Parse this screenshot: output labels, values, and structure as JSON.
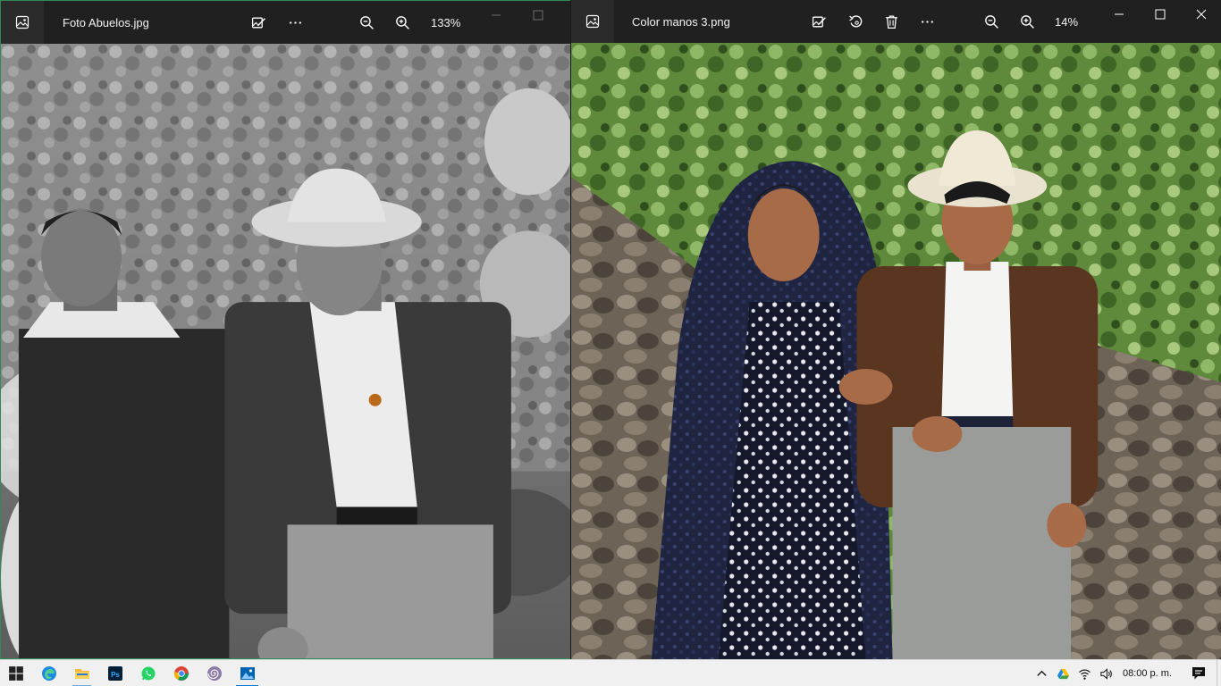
{
  "left_window": {
    "title": "Foto Abuelos.jpg",
    "zoom": "133%",
    "icons": [
      "photos-app-icon",
      "edit-image-icon",
      "more-icon",
      "zoom-out-icon",
      "zoom-in-icon",
      "minimize-icon",
      "maximize-icon"
    ],
    "photo_style": "black-and-white"
  },
  "right_window": {
    "title": "Color manos 3.png",
    "zoom": "14%",
    "icons": [
      "photos-app-icon",
      "edit-image-icon",
      "rotate-icon",
      "delete-icon",
      "more-icon",
      "zoom-out-icon",
      "zoom-in-icon",
      "minimize-icon",
      "maximize-icon",
      "close-icon"
    ],
    "photo_style": "colorized"
  },
  "taskbar": {
    "apps": [
      {
        "name": "Microsoft Edge",
        "icon": "edge-icon",
        "state": "idle"
      },
      {
        "name": "File Explorer",
        "icon": "folder-icon",
        "state": "open"
      },
      {
        "name": "Photoshop",
        "icon": "photoshop-icon",
        "state": "idle",
        "label": "Ps"
      },
      {
        "name": "WhatsApp",
        "icon": "whatsapp-icon",
        "state": "idle"
      },
      {
        "name": "Chrome",
        "icon": "chrome-icon",
        "state": "idle"
      },
      {
        "name": "App",
        "icon": "spiral-app-icon",
        "state": "idle"
      },
      {
        "name": "Photos",
        "icon": "photos-icon",
        "state": "active"
      }
    ],
    "clock": "08:00 p. m."
  },
  "colors": {
    "titlebar": "#202020",
    "taskbar": "#f0f0f0",
    "accent": "#0078d4",
    "left_border": "#2e8b57"
  }
}
